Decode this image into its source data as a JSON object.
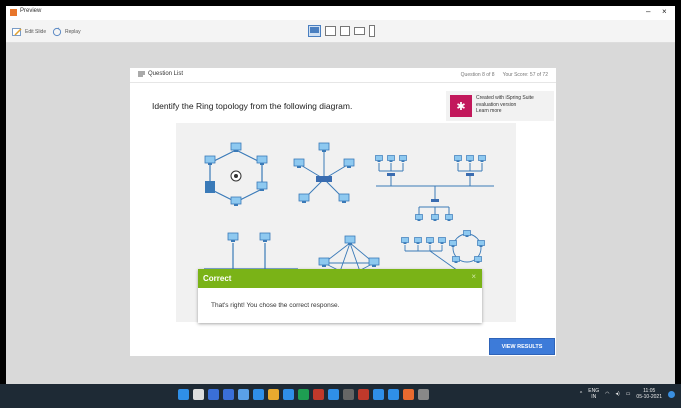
{
  "window": {
    "title": "Preview",
    "minimize_label": "–",
    "close_label": "×"
  },
  "toolbar": {
    "edit_slide_label": "Edit Slide",
    "replay_label": "Replay"
  },
  "slide": {
    "question_list_label": "Question List",
    "question_counter": "Question 8 of 8",
    "score": "Your Score: 57 of 72",
    "question_text": "Identify the Ring topology from the following diagram.",
    "ispring": {
      "line1": "Created with iSpring Suite",
      "line2": "evaluation version",
      "line3": "Learn more"
    },
    "feedback": {
      "title": "Correct",
      "message": "That's right! You chose the correct response."
    },
    "view_results_label": "VIEW RESULTS"
  },
  "taskbar": {
    "icon_colors": [
      "#2f8fe8",
      "#dddddd",
      "#3a6fd8",
      "#3a6fd8",
      "#5aa0e8",
      "#2f8fe8",
      "#e8a92f",
      "#2f8fe8",
      "#1e9e52",
      "#c0392b",
      "#2f8fe8",
      "#666",
      "#c0392b",
      "#2f8fe8",
      "#2f8fe8",
      "#e86a2f",
      "#888"
    ],
    "language_top": "ENG",
    "language_bottom": "IN",
    "time": "11:05",
    "date": "05-10-2021"
  },
  "colors": {
    "accent": "#3d7bd9",
    "correct": "#7ab317",
    "ispring": "#c2185b"
  }
}
